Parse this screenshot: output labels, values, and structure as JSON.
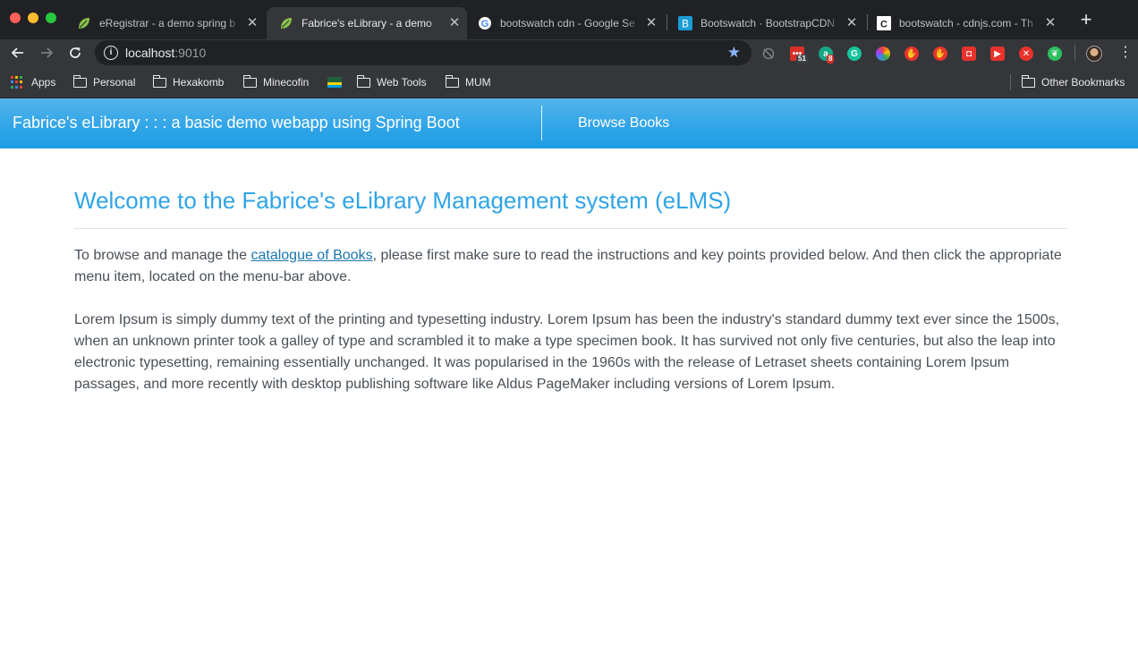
{
  "browser": {
    "tabs": [
      {
        "title": "eRegistrar - a demo spring b",
        "favicon": "spring-leaf-icon",
        "active": false
      },
      {
        "title": "Fabrice's eLibrary - a demo",
        "favicon": "spring-leaf-icon",
        "active": true
      },
      {
        "title": "bootswatch cdn - Google Se",
        "favicon": "google-icon",
        "active": false
      },
      {
        "title": "Bootswatch · BootstrapCDN",
        "favicon": "bootstrap-icon",
        "active": false
      },
      {
        "title": "bootswatch - cdnjs.com - Th",
        "favicon": "cdnjs-icon",
        "active": false
      }
    ],
    "address": {
      "host": "localhost",
      "port": ":9010"
    },
    "extensions": [
      {
        "name": "todo-extension-icon",
        "badge": "51",
        "color": "#d93025"
      },
      {
        "name": "grammarly-like-extension-icon",
        "badge": "8",
        "color": "#15a683"
      },
      {
        "name": "grammarly-icon",
        "badge": "",
        "color": "#15c39a"
      },
      {
        "name": "color-picker-icon",
        "badge": "",
        "color": "#f4b400"
      },
      {
        "name": "adblock-icon",
        "badge": "",
        "color": "#e8332c"
      },
      {
        "name": "hand-stop-icon",
        "badge": "",
        "color": "#e8332c"
      },
      {
        "name": "shield-icon",
        "badge": "",
        "color": "#e8332c"
      },
      {
        "name": "youtube-icon",
        "badge": "",
        "color": "#e8332c"
      },
      {
        "name": "block-x-icon",
        "badge": "",
        "color": "#e8332c"
      },
      {
        "name": "evernote-icon",
        "badge": "",
        "color": "#2dbe60"
      }
    ],
    "bookmarks": [
      {
        "label": "Apps",
        "icon": "apps-grid-icon"
      },
      {
        "label": "Personal",
        "icon": "folder-icon"
      },
      {
        "label": "Hexakomb",
        "icon": "folder-icon"
      },
      {
        "label": "Minecofin",
        "icon": "folder-icon"
      },
      {
        "label": "",
        "icon": "rwanda-flag-icon"
      },
      {
        "label": "Web Tools",
        "icon": "folder-icon"
      },
      {
        "label": "MUM",
        "icon": "folder-icon"
      }
    ],
    "other_bookmarks": "Other Bookmarks"
  },
  "app": {
    "brand": "Fabrice's eLibrary : : : a basic demo webapp using Spring Boot",
    "nav_link": "Browse Books",
    "accent_color": "#2fa4e7"
  },
  "content": {
    "title": "Welcome to the Fabrice's eLibrary Management system (eLMS)",
    "intro_before": "To browse and manage the ",
    "intro_link": "catalogue of Books",
    "intro_after": ", please first make sure to read the instructions and key points provided below. And then click the appropriate menu item, located on the menu-bar above.",
    "lorem": "Lorem Ipsum is simply dummy text of the printing and typesetting industry. Lorem Ipsum has been the industry's standard dummy text ever since the 1500s, when an unknown printer took a galley of type and scrambled it to make a type specimen book. It has survived not only five centuries, but also the leap into electronic typesetting, remaining essentially unchanged. It was popularised in the 1960s with the release of Letraset sheets containing Lorem Ipsum passages, and more recently with desktop publishing software like Aldus PageMaker including versions of Lorem Ipsum."
  }
}
